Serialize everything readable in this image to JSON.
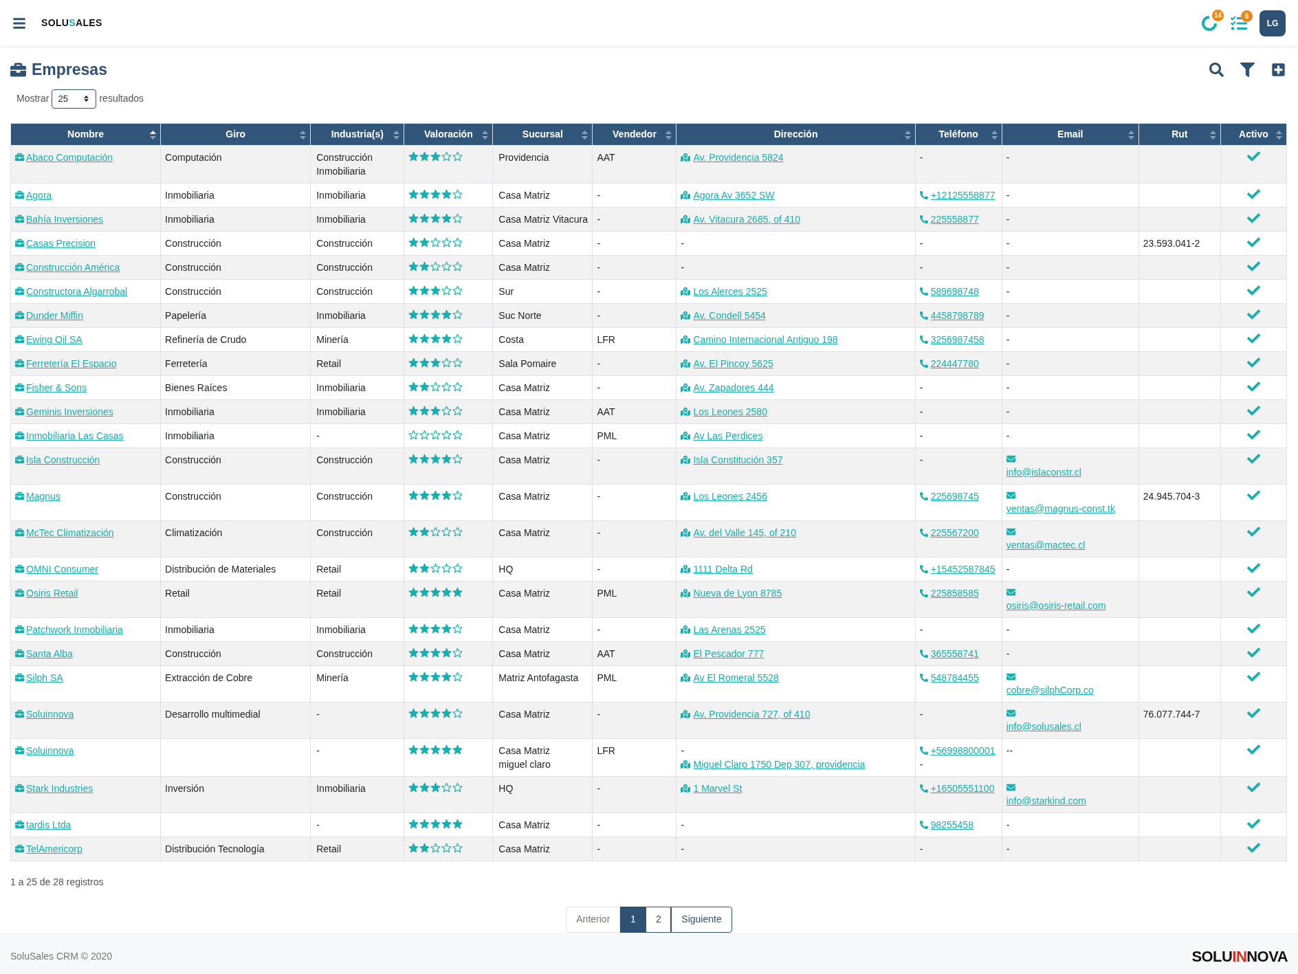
{
  "topbar": {
    "logo": {
      "left": "SOLU",
      "mark": "S",
      "right": "ALES"
    },
    "badges": [
      {
        "kind": "activity",
        "count": "14"
      },
      {
        "kind": "tasks",
        "count": "6"
      }
    ],
    "avatar": "LG"
  },
  "page": {
    "title": "Empresas",
    "length": {
      "before": "Mostrar",
      "value": "25",
      "after": "resultados"
    }
  },
  "table": {
    "columns": [
      {
        "label": "Nombre",
        "sorted": true
      },
      {
        "label": "Giro",
        "sorted": false
      },
      {
        "label": "Industria(s)",
        "sorted": false
      },
      {
        "label": "Valoración",
        "sorted": false
      },
      {
        "label": "Sucursal",
        "sorted": false
      },
      {
        "label": "Vendedor",
        "sorted": false
      },
      {
        "label": "Dirección",
        "sorted": false
      },
      {
        "label": "Teléfono",
        "sorted": false
      },
      {
        "label": "Email",
        "sorted": false
      },
      {
        "label": "Rut",
        "sorted": false
      },
      {
        "label": "Activo",
        "sorted": false
      }
    ],
    "rows": [
      {
        "name": "Abaco Computación",
        "giro": [
          "Computación"
        ],
        "industrias": [
          "Construcción",
          "Inmobiliaria"
        ],
        "stars": 3,
        "sucursal": [
          "Providencia"
        ],
        "vendedor": "AAT",
        "direccion": [
          {
            "kind": "address",
            "text": "Av. Providencia 5824"
          }
        ],
        "telefono": [
          {
            "kind": "text",
            "text": "-"
          }
        ],
        "email": [
          {
            "kind": "text",
            "text": "-"
          }
        ],
        "rut": "",
        "activo": true
      },
      {
        "name": "Agora",
        "giro": [
          "Inmobiliaria"
        ],
        "industrias": [
          "Inmobiliaria"
        ],
        "stars": 4,
        "sucursal": [
          "Casa Matriz"
        ],
        "vendedor": "-",
        "direccion": [
          {
            "kind": "address",
            "text": "Agora Av 3652 SW"
          }
        ],
        "telefono": [
          {
            "kind": "phone",
            "text": "+12125558877"
          }
        ],
        "email": [
          {
            "kind": "text",
            "text": "-"
          }
        ],
        "rut": "",
        "activo": true
      },
      {
        "name": "Bahía Inversiones",
        "giro": [
          "Inmobiliaria"
        ],
        "industrias": [
          "Inmobiliaria"
        ],
        "stars": 4,
        "sucursal": [
          "Casa Matriz Vitacura"
        ],
        "vendedor": "-",
        "direccion": [
          {
            "kind": "address",
            "text": "Av. Vitacura 2685, of 410"
          }
        ],
        "telefono": [
          {
            "kind": "phone",
            "text": "225558877"
          }
        ],
        "email": [
          {
            "kind": "text",
            "text": "-"
          }
        ],
        "rut": "",
        "activo": true
      },
      {
        "name": "Casas Precision",
        "giro": [
          "Construcción"
        ],
        "industrias": [
          "Construcción"
        ],
        "stars": 2,
        "sucursal": [
          "Casa Matriz"
        ],
        "vendedor": "-",
        "direccion": [
          {
            "kind": "text",
            "text": "-"
          }
        ],
        "telefono": [
          {
            "kind": "text",
            "text": "-"
          }
        ],
        "email": [
          {
            "kind": "text",
            "text": "-"
          }
        ],
        "rut": "23.593.041-2",
        "activo": true
      },
      {
        "name": "Construcción América",
        "giro": [
          "Construcción"
        ],
        "industrias": [
          "Construcción"
        ],
        "stars": 2,
        "sucursal": [
          "Casa Matriz"
        ],
        "vendedor": "-",
        "direccion": [
          {
            "kind": "text",
            "text": "-"
          }
        ],
        "telefono": [
          {
            "kind": "text",
            "text": "-"
          }
        ],
        "email": [
          {
            "kind": "text",
            "text": "-"
          }
        ],
        "rut": "",
        "activo": true
      },
      {
        "name": "Constructora Algarrobal",
        "giro": [
          "Construcción"
        ],
        "industrias": [
          "Construcción"
        ],
        "stars": 3,
        "sucursal": [
          "Sur"
        ],
        "vendedor": "-",
        "direccion": [
          {
            "kind": "address",
            "text": "Los Alerces 2525"
          }
        ],
        "telefono": [
          {
            "kind": "phone",
            "text": "589698748"
          }
        ],
        "email": [
          {
            "kind": "text",
            "text": "-"
          }
        ],
        "rut": "",
        "activo": true
      },
      {
        "name": "Dunder Miffin",
        "giro": [
          "Papelería"
        ],
        "industrias": [
          "Inmobiliaria"
        ],
        "stars": 4,
        "sucursal": [
          "Suc Norte"
        ],
        "vendedor": "-",
        "direccion": [
          {
            "kind": "address",
            "text": "Av. Condell 5454"
          }
        ],
        "telefono": [
          {
            "kind": "phone",
            "text": "4458798789"
          }
        ],
        "email": [
          {
            "kind": "text",
            "text": "-"
          }
        ],
        "rut": "",
        "activo": true
      },
      {
        "name": "Ewing Oil SA",
        "giro": [
          "Refinería de Crudo"
        ],
        "industrias": [
          "Minería"
        ],
        "stars": 4,
        "sucursal": [
          "Costa"
        ],
        "vendedor": "LFR",
        "direccion": [
          {
            "kind": "address",
            "text": "Camino Internacional Antiguo 198"
          }
        ],
        "telefono": [
          {
            "kind": "phone",
            "text": "3256987458"
          }
        ],
        "email": [
          {
            "kind": "text",
            "text": "-"
          }
        ],
        "rut": "",
        "activo": true
      },
      {
        "name": "Ferretería El Espacio",
        "giro": [
          "Ferretería"
        ],
        "industrias": [
          "Retail"
        ],
        "stars": 3,
        "sucursal": [
          "Sala Pomaire"
        ],
        "vendedor": "-",
        "direccion": [
          {
            "kind": "address",
            "text": "Av. El Pincoy 5625"
          }
        ],
        "telefono": [
          {
            "kind": "phone",
            "text": "224447780"
          }
        ],
        "email": [
          {
            "kind": "text",
            "text": "-"
          }
        ],
        "rut": "",
        "activo": true
      },
      {
        "name": "Fisher & Sons",
        "giro": [
          "Bienes Raíces"
        ],
        "industrias": [
          "Inmobiliaria"
        ],
        "stars": 2,
        "sucursal": [
          "Casa Matriz"
        ],
        "vendedor": "-",
        "direccion": [
          {
            "kind": "address",
            "text": "Av. Zapadores 444"
          }
        ],
        "telefono": [
          {
            "kind": "text",
            "text": "-"
          }
        ],
        "email": [
          {
            "kind": "text",
            "text": "-"
          }
        ],
        "rut": "",
        "activo": true
      },
      {
        "name": "Geminis Inversiones",
        "giro": [
          "Inmobiliaria"
        ],
        "industrias": [
          "Inmobiliaria"
        ],
        "stars": 3,
        "sucursal": [
          "Casa Matriz"
        ],
        "vendedor": "AAT",
        "direccion": [
          {
            "kind": "address",
            "text": "Los Leones 2580"
          }
        ],
        "telefono": [
          {
            "kind": "text",
            "text": "-"
          }
        ],
        "email": [
          {
            "kind": "text",
            "text": "-"
          }
        ],
        "rut": "",
        "activo": true
      },
      {
        "name": "Inmobiliaria Las Casas",
        "giro": [
          "Inmobiliaria"
        ],
        "industrias": [
          "-"
        ],
        "stars": 0,
        "sucursal": [
          "Casa Matriz"
        ],
        "vendedor": "PML",
        "direccion": [
          {
            "kind": "address",
            "text": "Av Las Perdices"
          }
        ],
        "telefono": [
          {
            "kind": "text",
            "text": "-"
          }
        ],
        "email": [
          {
            "kind": "text",
            "text": "-"
          }
        ],
        "rut": "",
        "activo": true
      },
      {
        "name": "Isla Construcción",
        "giro": [
          "Construcción"
        ],
        "industrias": [
          "Construcción"
        ],
        "stars": 4,
        "sucursal": [
          "Casa Matriz"
        ],
        "vendedor": "-",
        "direccion": [
          {
            "kind": "address",
            "text": "Isla Constitución 357"
          }
        ],
        "telefono": [
          {
            "kind": "text",
            "text": "-"
          }
        ],
        "email": [
          {
            "kind": "email",
            "text": "info@islaconstr.cl"
          }
        ],
        "rut": "",
        "activo": true
      },
      {
        "name": "Magnus",
        "giro": [
          "Construcción"
        ],
        "industrias": [
          "Construcción"
        ],
        "stars": 4,
        "sucursal": [
          "Casa Matriz"
        ],
        "vendedor": "-",
        "direccion": [
          {
            "kind": "address",
            "text": "Los Leones 2456"
          }
        ],
        "telefono": [
          {
            "kind": "phone",
            "text": "225698745"
          }
        ],
        "email": [
          {
            "kind": "email",
            "text": "ventas@magnus-const.tk"
          }
        ],
        "rut": "24.945.704-3",
        "activo": true
      },
      {
        "name": "McTec Climatización",
        "giro": [
          "Climatización"
        ],
        "industrias": [
          "Construcción"
        ],
        "stars": 2,
        "sucursal": [
          "Casa Matriz"
        ],
        "vendedor": "-",
        "direccion": [
          {
            "kind": "address",
            "text": "Av. del Valle 145, of 210"
          }
        ],
        "telefono": [
          {
            "kind": "phone",
            "text": "225567200"
          }
        ],
        "email": [
          {
            "kind": "email",
            "text": "ventas@mactec.cl"
          }
        ],
        "rut": "",
        "activo": true
      },
      {
        "name": "OMNI Consumer",
        "giro": [
          "Distribución de Materiales"
        ],
        "industrias": [
          "Retail"
        ],
        "stars": 2,
        "sucursal": [
          "HQ"
        ],
        "vendedor": "-",
        "direccion": [
          {
            "kind": "address",
            "text": "1111 Delta Rd"
          }
        ],
        "telefono": [
          {
            "kind": "phone",
            "text": "+15452587845"
          }
        ],
        "email": [
          {
            "kind": "text",
            "text": "-"
          }
        ],
        "rut": "",
        "activo": true
      },
      {
        "name": "Osiris Retail",
        "giro": [
          "Retail"
        ],
        "industrias": [
          "Retail"
        ],
        "stars": 5,
        "sucursal": [
          "Casa Matriz"
        ],
        "vendedor": "PML",
        "direccion": [
          {
            "kind": "address",
            "text": "Nueva de Lyon 8785"
          }
        ],
        "telefono": [
          {
            "kind": "phone",
            "text": "225858585"
          }
        ],
        "email": [
          {
            "kind": "email",
            "text": "osiris@osiris-retail.com"
          }
        ],
        "rut": "",
        "activo": true
      },
      {
        "name": "Patchwork Inmobiliaria",
        "giro": [
          "Inmobiliaria"
        ],
        "industrias": [
          "Inmobiliaria"
        ],
        "stars": 4,
        "sucursal": [
          "Casa Matriz"
        ],
        "vendedor": "-",
        "direccion": [
          {
            "kind": "address",
            "text": "Las Arenas 2525"
          }
        ],
        "telefono": [
          {
            "kind": "text",
            "text": "-"
          }
        ],
        "email": [
          {
            "kind": "text",
            "text": "-"
          }
        ],
        "rut": "",
        "activo": true
      },
      {
        "name": "Santa Alba",
        "giro": [
          "Construcción"
        ],
        "industrias": [
          "Construcción"
        ],
        "stars": 4,
        "sucursal": [
          "Casa Matriz"
        ],
        "vendedor": "AAT",
        "direccion": [
          {
            "kind": "address",
            "text": "El Pescador 777"
          }
        ],
        "telefono": [
          {
            "kind": "phone",
            "text": "365558741"
          }
        ],
        "email": [
          {
            "kind": "text",
            "text": "-"
          }
        ],
        "rut": "",
        "activo": true
      },
      {
        "name": "Silph SA",
        "giro": [
          "Extracción de Cobre"
        ],
        "industrias": [
          "Minería"
        ],
        "stars": 4,
        "sucursal": [
          "Matriz Antofagasta"
        ],
        "vendedor": "PML",
        "direccion": [
          {
            "kind": "address",
            "text": "Av El Romeral 5528"
          }
        ],
        "telefono": [
          {
            "kind": "phone",
            "text": "548784455"
          }
        ],
        "email": [
          {
            "kind": "email",
            "text": "cobre@silphCorp.co"
          }
        ],
        "rut": "",
        "activo": true
      },
      {
        "name": "Soluinnova",
        "giro": [
          "Desarrollo multimedial"
        ],
        "industrias": [
          "-"
        ],
        "stars": 4,
        "sucursal": [
          "Casa Matriz"
        ],
        "vendedor": "-",
        "direccion": [
          {
            "kind": "address",
            "text": "Av. Providencia 727, of 410"
          }
        ],
        "telefono": [
          {
            "kind": "text",
            "text": "-"
          }
        ],
        "email": [
          {
            "kind": "email",
            "text": "info@solusales.cl"
          }
        ],
        "rut": "76.077.744-7",
        "activo": true
      },
      {
        "name": "Soluinnova",
        "giro": [],
        "industrias": [
          "-"
        ],
        "stars": 5,
        "sucursal": [
          "Casa Matriz",
          "miguel claro"
        ],
        "vendedor": "LFR",
        "direccion": [
          {
            "kind": "text",
            "text": "-"
          },
          {
            "kind": "address",
            "text": "Miguel Claro 1750 Dep 307, providencia"
          }
        ],
        "telefono": [
          {
            "kind": "phone",
            "text": "+56998800001"
          },
          {
            "kind": "text",
            "text": "-"
          }
        ],
        "email": [
          {
            "kind": "text",
            "text": "--"
          }
        ],
        "rut": "",
        "activo": true
      },
      {
        "name": "Stark Industries",
        "giro": [
          "Inversión"
        ],
        "industrias": [
          "Inmobiliaria"
        ],
        "stars": 3,
        "sucursal": [
          "HQ"
        ],
        "vendedor": "-",
        "direccion": [
          {
            "kind": "address",
            "text": "1 Marvel St"
          }
        ],
        "telefono": [
          {
            "kind": "phone",
            "text": "+16505551100"
          }
        ],
        "email": [
          {
            "kind": "email",
            "text": "info@starkind.com"
          }
        ],
        "rut": "",
        "activo": true
      },
      {
        "name": "tardis Ltda",
        "giro": [],
        "industrias": [
          "-"
        ],
        "stars": 5,
        "sucursal": [
          "Casa Matriz"
        ],
        "vendedor": "-",
        "direccion": [
          {
            "kind": "text",
            "text": "-"
          }
        ],
        "telefono": [
          {
            "kind": "phone",
            "text": "98255458"
          }
        ],
        "email": [
          {
            "kind": "text",
            "text": "-"
          }
        ],
        "rut": "",
        "activo": true
      },
      {
        "name": "TelAmericorp",
        "giro": [
          "Distribución Tecnología"
        ],
        "industrias": [
          "Retail"
        ],
        "stars": 2,
        "sucursal": [
          "Casa Matriz"
        ],
        "vendedor": "-",
        "direccion": [
          {
            "kind": "text",
            "text": "-"
          }
        ],
        "telefono": [
          {
            "kind": "text",
            "text": "-"
          }
        ],
        "email": [
          {
            "kind": "text",
            "text": "-"
          }
        ],
        "rut": "",
        "activo": true
      }
    ]
  },
  "info": "1 a 25 de 28 registros",
  "pagination": {
    "previous": "Anterior",
    "pages": [
      {
        "label": "1",
        "selected": true
      },
      {
        "label": "2",
        "selected": false
      }
    ],
    "next": "Siguiente"
  },
  "footer": {
    "copyright": "SoluSales CRM © 2020",
    "logo": {
      "left": "SOLU",
      "mark": "IN",
      "right": "NOVA"
    }
  }
}
